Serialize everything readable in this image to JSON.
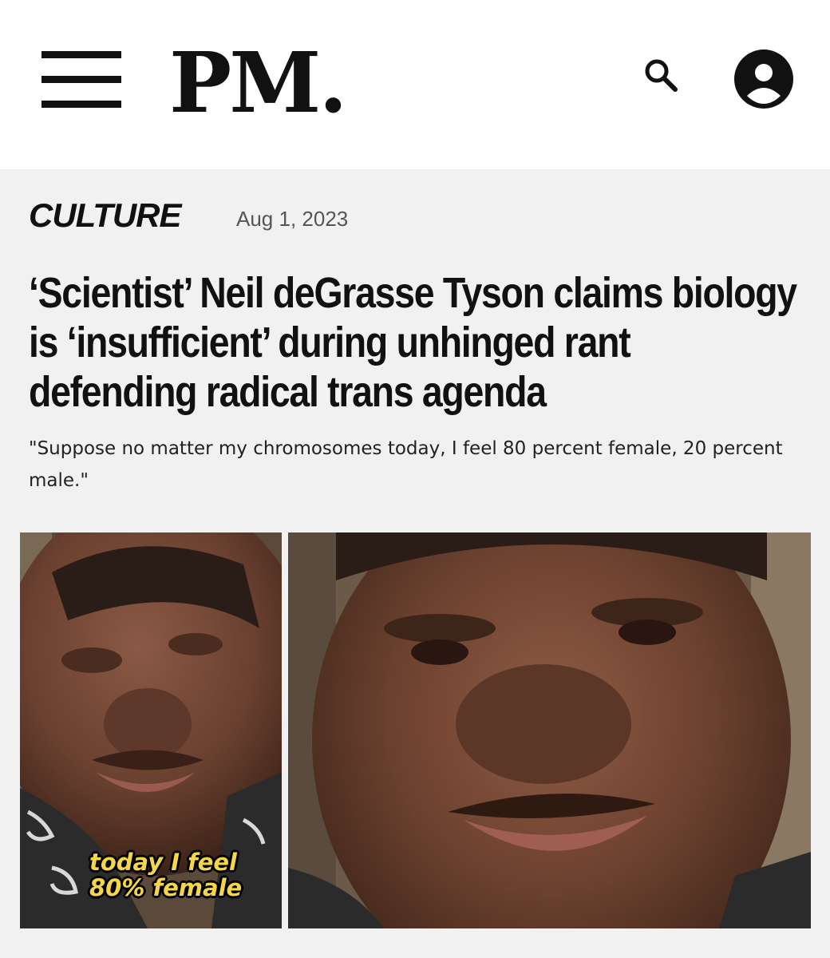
{
  "header": {
    "menu_icon": "hamburger-menu-icon",
    "logo": "PM.",
    "search_icon": "search-icon",
    "account_icon": "user-account-icon"
  },
  "article": {
    "category": "CULTURE",
    "date": "Aug 1, 2023",
    "headline": "‘Scientist’ Neil deGrasse Tyson claims biology is ‘insufficient’ during unhinged rant defending radical trans agenda",
    "subhead": "\"Suppose no matter my chromosomes today, I feel 80 percent female, 20 percent male.\"",
    "image": {
      "caption_line1": "today I feel",
      "caption_line2": "80% female"
    }
  },
  "colors": {
    "header_bg": "#ffffff",
    "page_bg": "#f1f1f1",
    "text": "#111111",
    "caption": "#f5d64a"
  }
}
